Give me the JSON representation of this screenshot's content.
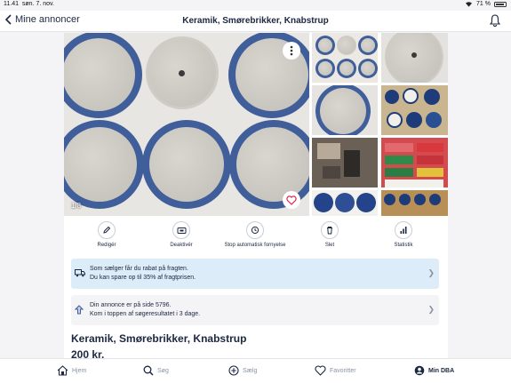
{
  "status_bar": {
    "time": "11.41",
    "date": "søn. 7. nov.",
    "battery": "71 %"
  },
  "nav": {
    "back_label": "Mine annoncer",
    "title": "Keramik, Smørebrikker, Knabstrup"
  },
  "gallery": {
    "counter": "1/8",
    "thumbnail_count": 8
  },
  "actions": [
    {
      "label": "Redigér",
      "icon": "pencil-icon"
    },
    {
      "label": "Deaktivér",
      "icon": "deactivate-icon"
    },
    {
      "label": "Stop automatisk fornyelse",
      "icon": "renew-icon"
    },
    {
      "label": "Slet",
      "icon": "trash-icon"
    },
    {
      "label": "Statistik",
      "icon": "bar-chart-icon"
    }
  ],
  "shipping_banner": {
    "line1": "Som sælger får du rabat på fragten.",
    "line2": "Du kan spare op til 35% af fragtprisen."
  },
  "position_banner": {
    "line1": "Din annonce er på side 5796.",
    "line2": "Kom i toppen af søgeresultatet i 3 dage."
  },
  "ad": {
    "title": "Keramik, Smørebrikker, Knabstrup",
    "price": "200 kr."
  },
  "tabbar": [
    {
      "label": "Hjem",
      "icon": "home-icon",
      "active": false
    },
    {
      "label": "Søg",
      "icon": "search-icon",
      "active": false
    },
    {
      "label": "Sælg",
      "icon": "plus-circle-icon",
      "active": false
    },
    {
      "label": "Favoritter",
      "icon": "heart-icon",
      "active": false
    },
    {
      "label": "Min DBA",
      "icon": "profile-icon",
      "active": true
    }
  ],
  "colors": {
    "brand_navy": "#1c2741",
    "plate_blue": "#3f5e9a",
    "info_banner": "#dcecf8"
  }
}
